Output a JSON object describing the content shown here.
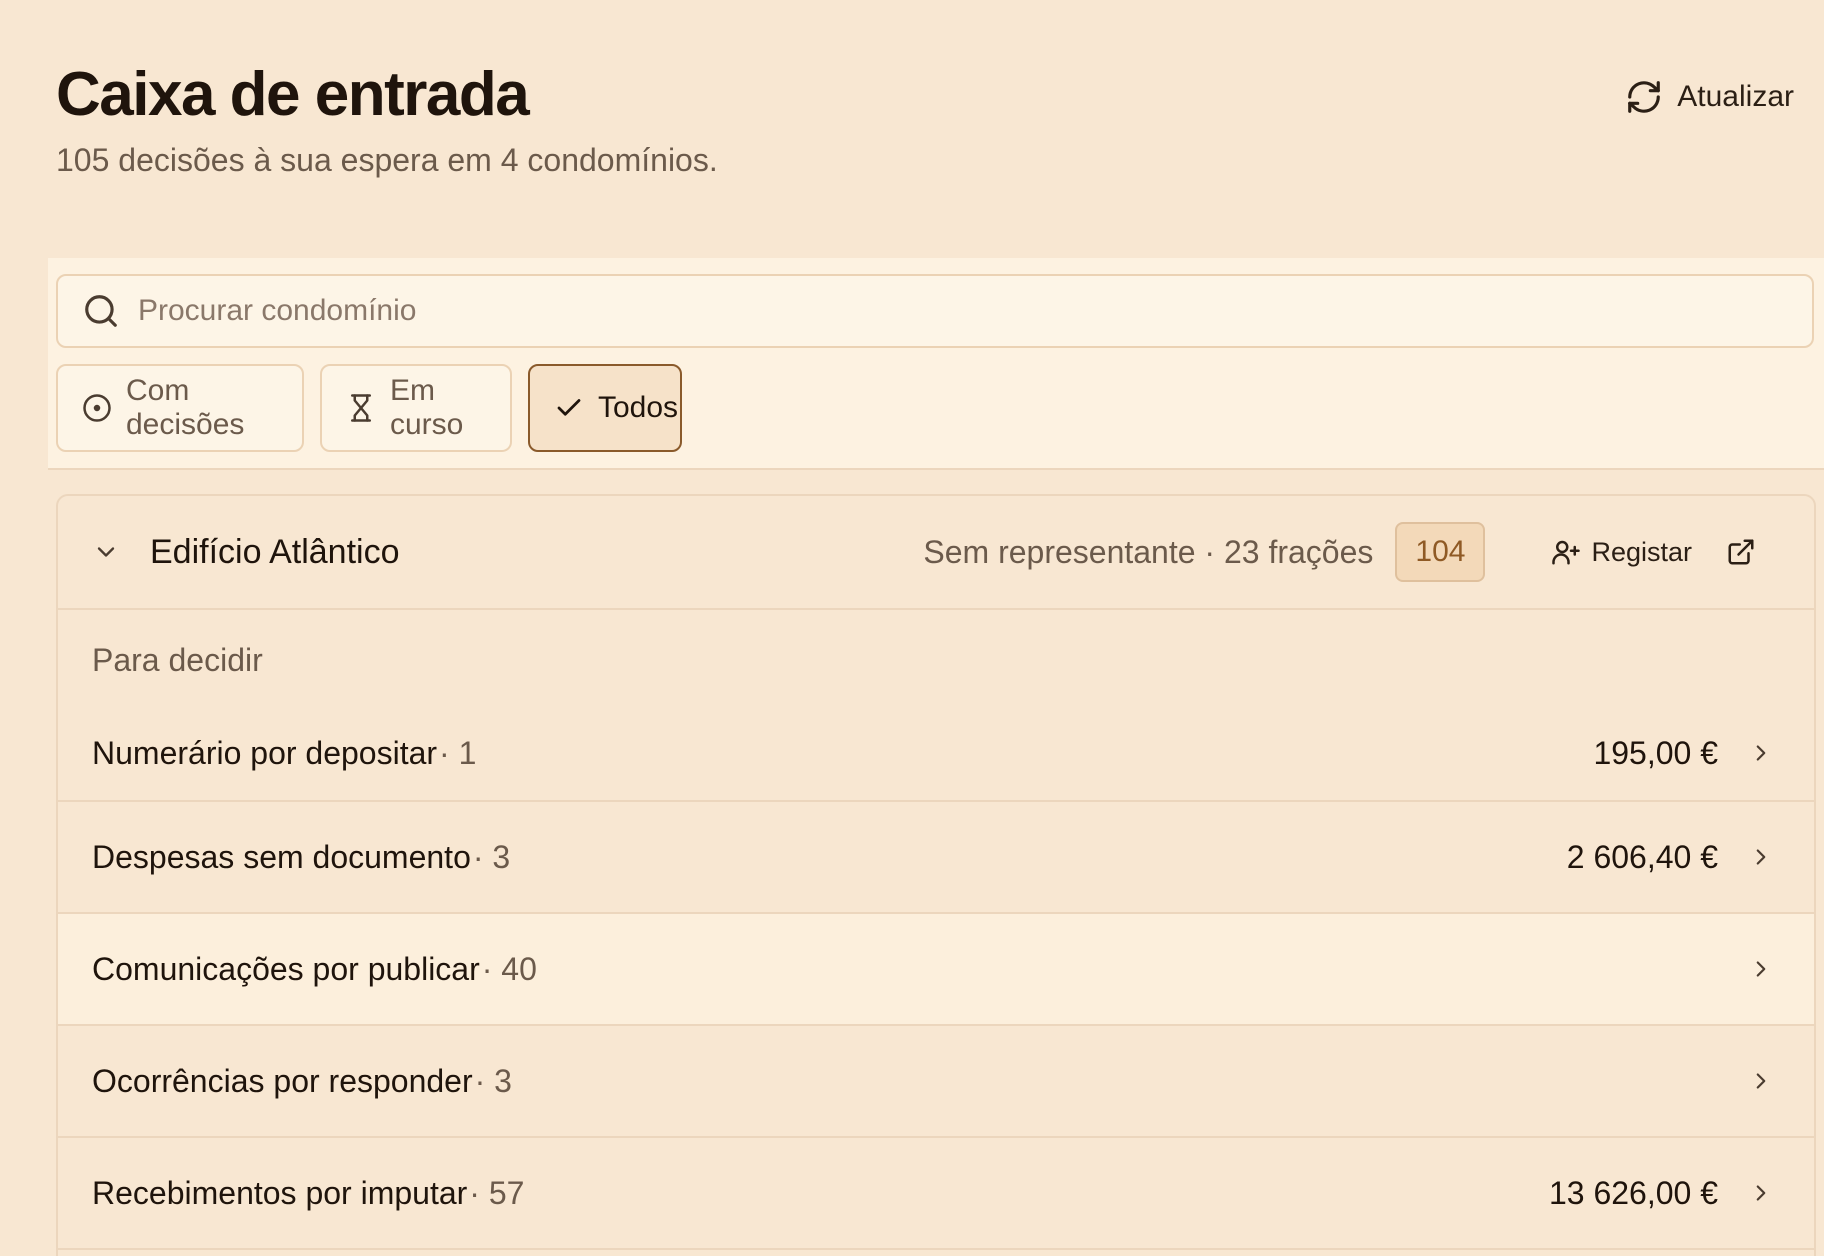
{
  "header": {
    "title": "Caixa de entrada",
    "subtitle": "105 decisões à sua espera em 4 condomínios.",
    "refresh_label": "Atualizar"
  },
  "search": {
    "placeholder": "Procurar condomínio",
    "value": ""
  },
  "filters": [
    {
      "label": "Com decisões",
      "icon": "circle-dot-icon",
      "active": false
    },
    {
      "label": "Em curso",
      "icon": "hourglass-icon",
      "active": false
    },
    {
      "label": "Todos",
      "icon": "check-icon",
      "active": true
    }
  ],
  "building": {
    "name": "Edifício Atlântico",
    "meta": "Sem representante · 23 frações",
    "badge_count": "104",
    "register_label": "Registar",
    "section_label": "Para decidir",
    "rows": [
      {
        "label": "Numerário por depositar",
        "count": "· 1",
        "amount": "195,00 €"
      },
      {
        "label": "Despesas sem documento",
        "count": "· 3",
        "amount": "2 606,40 €"
      },
      {
        "label": "Comunicações por publicar",
        "count": "· 40",
        "amount": ""
      },
      {
        "label": "Ocorrências por responder",
        "count": "· 3",
        "amount": ""
      },
      {
        "label": "Recebimentos por imputar",
        "count": "· 57",
        "amount": "13 626,00 €"
      }
    ]
  },
  "colors": {
    "background": "#f8e7d2",
    "panel": "#fdf2e1",
    "accent_border": "#8a5a2b",
    "badge_text": "#8f5a25"
  }
}
